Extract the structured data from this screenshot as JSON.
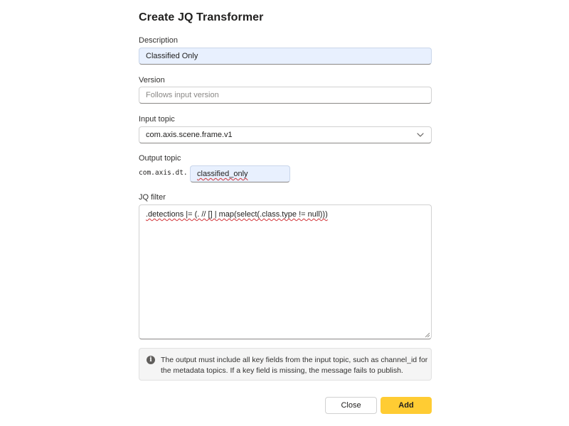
{
  "dialog": {
    "title": "Create JQ Transformer"
  },
  "description": {
    "label": "Description",
    "value": "Classified Only"
  },
  "version": {
    "label": "Version",
    "placeholder": "Follows input version"
  },
  "input_topic": {
    "label": "Input topic",
    "selected": "com.axis.scene.frame.v1"
  },
  "output_topic": {
    "label": "Output topic",
    "prefix": "com.axis.dt.",
    "value": "classified_only"
  },
  "jq_filter": {
    "label": "JQ filter",
    "value": ".detections |= (. // [] | map(select(.class.type != null)))"
  },
  "info": {
    "icon": "info-icon",
    "text": "The output must include all key fields from the input topic, such as channel_id for the metadata topics. If a key field is missing, the message fails to publish."
  },
  "actions": {
    "close_label": "Close",
    "add_label": "Add",
    "add_color": "#ffcc33"
  }
}
